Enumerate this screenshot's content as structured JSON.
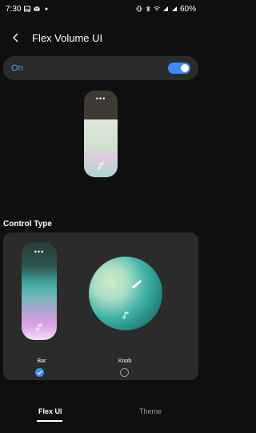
{
  "status_bar": {
    "time": "7:30",
    "battery": "60%",
    "left_icons": [
      "image-icon",
      "mail-icon",
      "dot-icon"
    ],
    "right_icons": [
      "vibrate-icon",
      "bluetooth-icon",
      "wifi-icon",
      "signal-icon",
      "signal-icon"
    ]
  },
  "header": {
    "title": "Flex Volume UI"
  },
  "toggle_row": {
    "label": "On",
    "enabled": true
  },
  "preview": {
    "menu_dots": "•••",
    "icon": "music-note-icon"
  },
  "control_type": {
    "title": "Control Type",
    "options": [
      {
        "label": "Bar",
        "selected": true,
        "menu_dots": "•••",
        "icon": "music-note-icon"
      },
      {
        "label": "Knob",
        "selected": false,
        "icon": "music-note-icon"
      }
    ]
  },
  "tabs": [
    {
      "label": "Flex UI",
      "active": true
    },
    {
      "label": "Theme",
      "active": false
    }
  ],
  "colors": {
    "accent": "#3e8df3",
    "background": "#0f0f0f",
    "card": "#2b2b2b"
  }
}
